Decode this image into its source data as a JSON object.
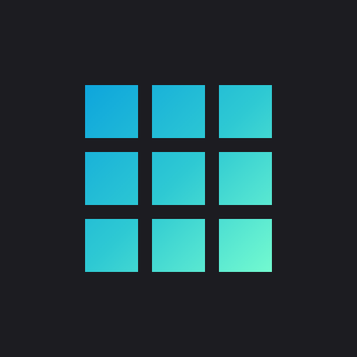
{
  "icon": {
    "name": "nine-square-grid-icon",
    "background_color": "#1c1c21",
    "gradient_start": "#0ea5dc",
    "gradient_mid": "#2ec9d3",
    "gradient_end": "#73fad0",
    "rows": 3,
    "columns": 3
  }
}
